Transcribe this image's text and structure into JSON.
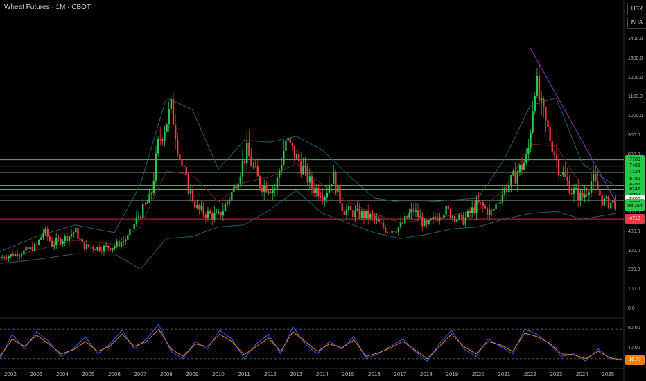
{
  "header": {
    "title": "Wheat Futures · 1M · CBOT"
  },
  "controls": {
    "currency_label": "USX",
    "buy_label": "BUA"
  },
  "price_tags": [
    {
      "label": "7789",
      "color": "#26c94a",
      "value": 778.9
    },
    {
      "label": "7465",
      "color": "#26c94a",
      "value": 746.5
    },
    {
      "label": "7124",
      "color": "#26c94a",
      "value": 712.4
    },
    {
      "label": "6782",
      "color": "#26c94a",
      "value": 678.2
    },
    {
      "label": "6456",
      "color": "#26c94a",
      "value": 645.6
    },
    {
      "label": "6242",
      "color": "#26c94a",
      "value": 624.2
    },
    {
      "label": "5952",
      "color": "#26c94a",
      "value": 595.2
    },
    {
      "label": "5690",
      "color": "#ffffff",
      "value": 569.0
    },
    {
      "label": "5522",
      "color": "#26c94a",
      "value": 552.2
    },
    {
      "label": "9d 15h",
      "color": "#26c94a",
      "value": 537
    },
    {
      "label": "4710",
      "color": "#f23645",
      "value": 471.0
    }
  ],
  "oscillator_tags": [
    {
      "label": "18.96",
      "color": "#2962ff",
      "value": 18.96
    },
    {
      "label": "16.77",
      "color": "#f57c00",
      "value": 16.77
    }
  ],
  "colors": {
    "up": "#26c94a",
    "down": "#f23645",
    "band": "#1f5f6b",
    "basis": "#6b1d1d",
    "hline": "#7fc97f",
    "trend": "#7b2fa8"
  },
  "chart_data": [
    {
      "type": "candlestick",
      "title": "Wheat Futures · 1M · CBOT",
      "unit": "USX",
      "ylim": [
        0,
        1400
      ],
      "y_ticks": [
        "1400.0",
        "1300.0",
        "1200.0",
        "1100.0",
        "1000.0",
        "900.0",
        "800.0",
        "700.0",
        "600.0",
        "500.0",
        "400.0",
        "300.0",
        "200.0",
        "100.0",
        "0.0"
      ],
      "x_ticks": [
        "2002",
        "2003",
        "2004",
        "2005",
        "2006",
        "2007",
        "2008",
        "2009",
        "2010",
        "2011",
        "2012",
        "2013",
        "2014",
        "2015",
        "2016",
        "2017",
        "2018",
        "2019",
        "2020",
        "2021",
        "2022",
        "2023",
        "2024",
        "2025"
      ],
      "series": {
        "close_path": [
          {
            "x": 2001.6,
            "y": 270
          },
          {
            "x": 2002.5,
            "y": 300
          },
          {
            "x": 2003.0,
            "y": 330
          },
          {
            "x": 2003.3,
            "y": 410
          },
          {
            "x": 2003.6,
            "y": 340
          },
          {
            "x": 2004.2,
            "y": 380
          },
          {
            "x": 2004.5,
            "y": 410
          },
          {
            "x": 2004.8,
            "y": 330
          },
          {
            "x": 2005.5,
            "y": 320
          },
          {
            "x": 2006.0,
            "y": 330
          },
          {
            "x": 2006.5,
            "y": 370
          },
          {
            "x": 2006.9,
            "y": 480
          },
          {
            "x": 2007.4,
            "y": 580
          },
          {
            "x": 2007.7,
            "y": 870
          },
          {
            "x": 2008.2,
            "y": 1050
          },
          {
            "x": 2008.5,
            "y": 800
          },
          {
            "x": 2008.8,
            "y": 650
          },
          {
            "x": 2009.2,
            "y": 520
          },
          {
            "x": 2009.5,
            "y": 500
          },
          {
            "x": 2010.0,
            "y": 480
          },
          {
            "x": 2010.5,
            "y": 600
          },
          {
            "x": 2011.1,
            "y": 820
          },
          {
            "x": 2011.6,
            "y": 650
          },
          {
            "x": 2012.2,
            "y": 630
          },
          {
            "x": 2012.6,
            "y": 880
          },
          {
            "x": 2013.1,
            "y": 770
          },
          {
            "x": 2013.6,
            "y": 640
          },
          {
            "x": 2014.1,
            "y": 600
          },
          {
            "x": 2014.4,
            "y": 700
          },
          {
            "x": 2014.8,
            "y": 520
          },
          {
            "x": 2015.3,
            "y": 500
          },
          {
            "x": 2015.9,
            "y": 480
          },
          {
            "x": 2016.5,
            "y": 410
          },
          {
            "x": 2017.0,
            "y": 430
          },
          {
            "x": 2017.5,
            "y": 520
          },
          {
            "x": 2018.0,
            "y": 430
          },
          {
            "x": 2018.7,
            "y": 520
          },
          {
            "x": 2019.4,
            "y": 460
          },
          {
            "x": 2020.0,
            "y": 550
          },
          {
            "x": 2020.5,
            "y": 500
          },
          {
            "x": 2020.9,
            "y": 600
          },
          {
            "x": 2021.4,
            "y": 690
          },
          {
            "x": 2021.9,
            "y": 790
          },
          {
            "x": 2022.2,
            "y": 1200
          },
          {
            "x": 2022.4,
            "y": 1050
          },
          {
            "x": 2022.8,
            "y": 880
          },
          {
            "x": 2023.1,
            "y": 740
          },
          {
            "x": 2023.6,
            "y": 620
          },
          {
            "x": 2024.0,
            "y": 580
          },
          {
            "x": 2024.4,
            "y": 680
          },
          {
            "x": 2024.8,
            "y": 560
          },
          {
            "x": 2025.3,
            "y": 552
          }
        ],
        "basis_ma": [
          {
            "x": 2001.6,
            "y": 260
          },
          {
            "x": 2003.0,
            "y": 310
          },
          {
            "x": 2004.5,
            "y": 360
          },
          {
            "x": 2006.0,
            "y": 340
          },
          {
            "x": 2007.0,
            "y": 430
          },
          {
            "x": 2008.0,
            "y": 720
          },
          {
            "x": 2009.0,
            "y": 700
          },
          {
            "x": 2010.0,
            "y": 560
          },
          {
            "x": 2011.0,
            "y": 660
          },
          {
            "x": 2012.0,
            "y": 690
          },
          {
            "x": 2013.0,
            "y": 760
          },
          {
            "x": 2014.0,
            "y": 650
          },
          {
            "x": 2015.0,
            "y": 560
          },
          {
            "x": 2016.0,
            "y": 500
          },
          {
            "x": 2017.0,
            "y": 450
          },
          {
            "x": 2018.0,
            "y": 470
          },
          {
            "x": 2019.0,
            "y": 490
          },
          {
            "x": 2020.0,
            "y": 520
          },
          {
            "x": 2021.0,
            "y": 620
          },
          {
            "x": 2022.0,
            "y": 860
          },
          {
            "x": 2023.0,
            "y": 850
          },
          {
            "x": 2024.0,
            "y": 640
          },
          {
            "x": 2025.3,
            "y": 560
          }
        ],
        "upper_band": [
          {
            "x": 2001.6,
            "y": 300
          },
          {
            "x": 2003.0,
            "y": 380
          },
          {
            "x": 2004.5,
            "y": 440
          },
          {
            "x": 2006.0,
            "y": 400
          },
          {
            "x": 2007.0,
            "y": 650
          },
          {
            "x": 2008.0,
            "y": 1100
          },
          {
            "x": 2009.0,
            "y": 1040
          },
          {
            "x": 2010.0,
            "y": 730
          },
          {
            "x": 2011.0,
            "y": 880
          },
          {
            "x": 2012.0,
            "y": 870
          },
          {
            "x": 2013.0,
            "y": 900
          },
          {
            "x": 2014.0,
            "y": 830
          },
          {
            "x": 2015.0,
            "y": 700
          },
          {
            "x": 2016.0,
            "y": 580
          },
          {
            "x": 2017.0,
            "y": 560
          },
          {
            "x": 2018.0,
            "y": 560
          },
          {
            "x": 2019.0,
            "y": 570
          },
          {
            "x": 2020.0,
            "y": 580
          },
          {
            "x": 2021.0,
            "y": 780
          },
          {
            "x": 2022.0,
            "y": 1060
          },
          {
            "x": 2023.0,
            "y": 1100
          },
          {
            "x": 2024.0,
            "y": 760
          },
          {
            "x": 2025.3,
            "y": 640
          }
        ],
        "lower_band": [
          {
            "x": 2001.6,
            "y": 240
          },
          {
            "x": 2003.0,
            "y": 260
          },
          {
            "x": 2004.5,
            "y": 290
          },
          {
            "x": 2006.0,
            "y": 290
          },
          {
            "x": 2007.0,
            "y": 210
          },
          {
            "x": 2008.0,
            "y": 370
          },
          {
            "x": 2009.0,
            "y": 380
          },
          {
            "x": 2010.0,
            "y": 430
          },
          {
            "x": 2011.0,
            "y": 440
          },
          {
            "x": 2012.0,
            "y": 520
          },
          {
            "x": 2013.0,
            "y": 620
          },
          {
            "x": 2014.0,
            "y": 500
          },
          {
            "x": 2015.0,
            "y": 450
          },
          {
            "x": 2016.0,
            "y": 400
          },
          {
            "x": 2017.0,
            "y": 370
          },
          {
            "x": 2018.0,
            "y": 390
          },
          {
            "x": 2019.0,
            "y": 420
          },
          {
            "x": 2020.0,
            "y": 430
          },
          {
            "x": 2021.0,
            "y": 470
          },
          {
            "x": 2022.0,
            "y": 500
          },
          {
            "x": 2023.0,
            "y": 510
          },
          {
            "x": 2024.0,
            "y": 470
          },
          {
            "x": 2025.3,
            "y": 500
          }
        ]
      },
      "horizontal_levels": [
        778.9,
        746.5,
        712.4,
        678.2,
        645.6,
        624.2,
        595.2,
        569.0,
        471.0
      ],
      "trendline": [
        {
          "x": 2022.0,
          "y": 1360
        },
        {
          "x": 2025.3,
          "y": 560
        }
      ]
    },
    {
      "type": "line",
      "title": "",
      "ylim": [
        0,
        100
      ],
      "y_ticks": [
        "80.00",
        "40.00"
      ],
      "series": [
        {
          "values": [
            20,
            70,
            40,
            75,
            55,
            25,
            40,
            65,
            30,
            50,
            78,
            40,
            60,
            90,
            35,
            20,
            55,
            40,
            78,
            60,
            20,
            50,
            70,
            30,
            85,
            50,
            30,
            55,
            40,
            65,
            20,
            30,
            45,
            60,
            35,
            15,
            50,
            78,
            40,
            25,
            60,
            45,
            30,
            80,
            70,
            50,
            25,
            30,
            15,
            40,
            20,
            18.96
          ]
        },
        {
          "values": [
            25,
            60,
            45,
            68,
            50,
            30,
            38,
            55,
            35,
            45,
            70,
            45,
            55,
            80,
            40,
            25,
            50,
            45,
            70,
            55,
            28,
            45,
            62,
            35,
            75,
            55,
            35,
            50,
            42,
            58,
            25,
            32,
            42,
            55,
            38,
            20,
            45,
            70,
            45,
            30,
            55,
            48,
            35,
            72,
            65,
            52,
            30,
            28,
            20,
            35,
            22,
            16.77
          ]
        }
      ],
      "levels": [
        80,
        50,
        20
      ]
    }
  ]
}
